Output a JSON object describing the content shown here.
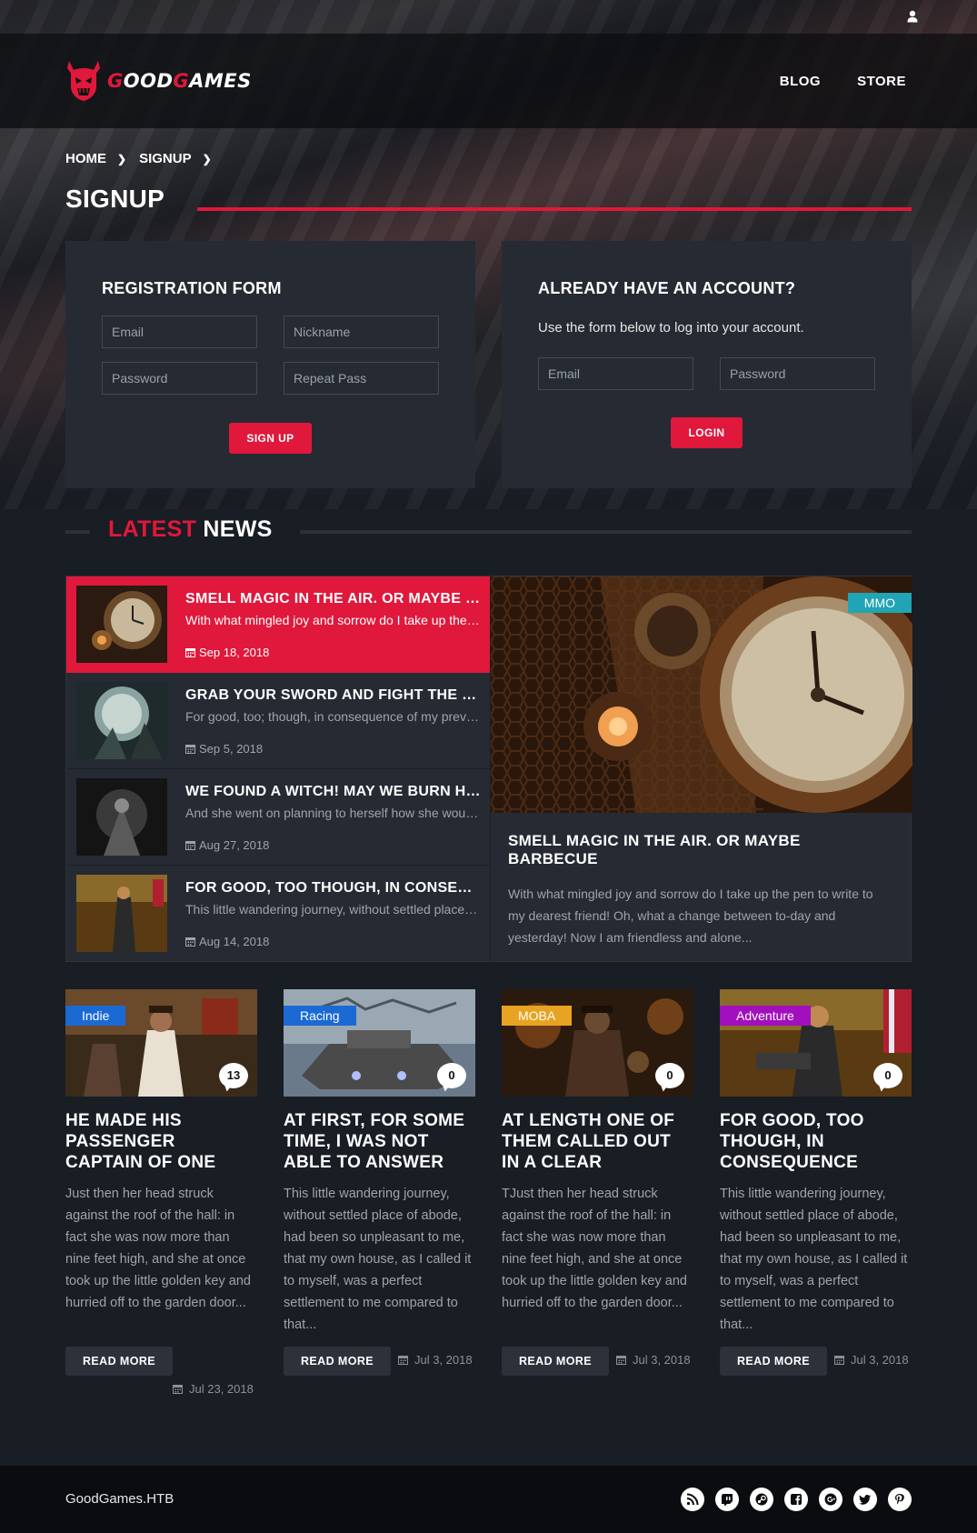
{
  "header": {
    "logo_text_parts": [
      "G",
      "OOD",
      "G",
      "AMES"
    ],
    "nav": [
      "BLOG",
      "STORE"
    ]
  },
  "breadcrumb": [
    "HOME",
    "SIGNUP"
  ],
  "page_title": "SIGNUP",
  "registration": {
    "title": "REGISTRATION FORM",
    "email_placeholder": "Email",
    "nickname_placeholder": "Nickname",
    "password_placeholder": "Password",
    "repeat_placeholder": "Repeat Pass",
    "button": "SIGN UP"
  },
  "login": {
    "title": "ALREADY HAVE AN ACCOUNT?",
    "description": "Use the form below to log into your account.",
    "email_placeholder": "Email",
    "password_placeholder": "Password",
    "button": "LOGIN"
  },
  "latest_news": {
    "title_red": "LATEST",
    "title_white": "NEWS",
    "items": [
      {
        "title": "SMELL MAGIC IN THE AIR. OR MAYBE BARBECUE",
        "excerpt": "With what mingled joy and sorrow do I take up the pen to write",
        "date": "Sep 18, 2018"
      },
      {
        "title": "GRAB YOUR SWORD AND FIGHT THE HORDE",
        "excerpt": "For good, too; though, in consequence of my previous emotions",
        "date": "Sep 5, 2018"
      },
      {
        "title": "WE FOUND A WITCH! MAY WE BURN HER?",
        "excerpt": "And she went on planning to herself how she would manage it",
        "date": "Aug 27, 2018"
      },
      {
        "title": "FOR GOOD, TOO THOUGH, IN CONSEQUENCE",
        "excerpt": "This little wandering journey, without settled place of abode",
        "date": "Aug 14, 2018"
      }
    ],
    "featured": {
      "tag": "MMO",
      "title": "SMELL MAGIC IN THE AIR. OR MAYBE BARBECUE",
      "excerpt": "With what mingled joy and sorrow do I take up the pen to write to my dearest friend! Oh, what a change between to-day and yesterday! Now I am friendless and alone..."
    }
  },
  "cards": [
    {
      "tag": "Indie",
      "tag_color": "#1b6ad4",
      "comments": "13",
      "title": "HE MADE HIS PASSENGER CAPTAIN OF ONE",
      "excerpt": "Just then her head struck against the roof of the hall: in fact she was now more than nine feet high, and she at once took up the little golden key and hurried off to the garden door...",
      "button": "READ MORE",
      "date": "Jul 23, 2018"
    },
    {
      "tag": "Racing",
      "tag_color": "#1b6ad4",
      "comments": "0",
      "title": "AT FIRST, FOR SOME TIME, I WAS NOT ABLE TO ANSWER",
      "excerpt": "This little wandering journey, without settled place of abode, had been so unpleasant to me, that my own house, as I called it to myself, was a perfect settlement to me compared to that...",
      "button": "READ MORE",
      "date": "Jul 3, 2018"
    },
    {
      "tag": "MOBA",
      "tag_color": "#e8a322",
      "comments": "0",
      "title": "AT LENGTH ONE OF THEM CALLED OUT IN A CLEAR",
      "excerpt": "TJust then her head struck against the roof of the hall: in fact she was now more than nine feet high, and she at once took up the little golden key and hurried off to the garden door...",
      "button": "READ MORE",
      "date": "Jul 3, 2018"
    },
    {
      "tag": "Adventure",
      "tag_color": "#a20fbd",
      "comments": "0",
      "title": "FOR GOOD, TOO THOUGH, IN CONSEQUENCE",
      "excerpt": "This little wandering journey, without settled place of abode, had been so unpleasant to me, that my own house, as I called it to myself, was a perfect settlement to me compared to that...",
      "button": "READ MORE",
      "date": "Jul 3, 2018"
    }
  ],
  "footer": {
    "brand": "GoodGames.HTB",
    "socials": [
      "rss-icon",
      "twitch-icon",
      "steam-icon",
      "facebook-icon",
      "google-plus-icon",
      "twitter-icon",
      "pinterest-icon"
    ]
  },
  "colors": {
    "accent": "#e0183b",
    "mmo_tag": "#21a4b5",
    "panel": "#262a33",
    "background": "#191d24"
  }
}
